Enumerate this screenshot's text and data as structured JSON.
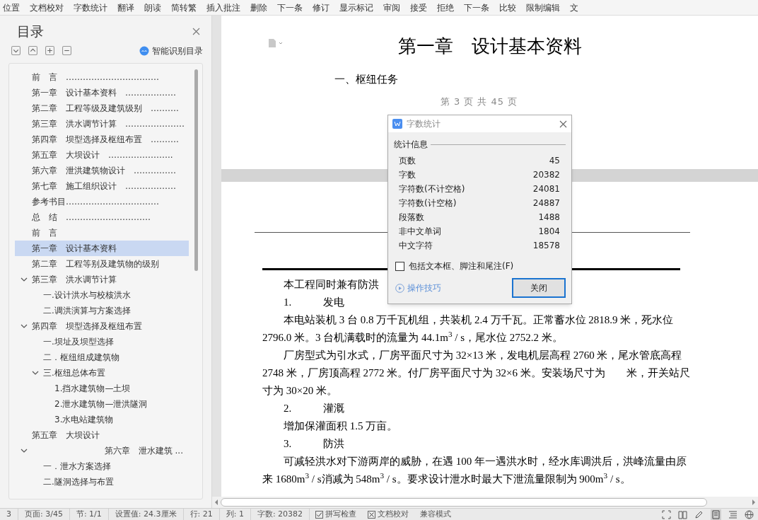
{
  "toolbar": [
    "位置",
    "文档校对",
    "字数统计",
    "翻译",
    "朗读",
    "简转繁",
    "插入批注",
    "删除",
    "下一条",
    "修订",
    "显示标记",
    "审阅",
    "接受",
    "拒绝",
    "下一条",
    "比较",
    "限制编辑",
    "文"
  ],
  "sidebar": {
    "title": "目录",
    "smart_button": "智能识别目录",
    "items": [
      {
        "text": "前　言　……………………………",
        "selected": false
      },
      {
        "text": "第一章　设计基本资料　………………",
        "selected": false
      },
      {
        "text": "第二章　工程等级及建筑级别　……….",
        "selected": false
      },
      {
        "text": "第三章　洪水调节计算　…………………",
        "selected": false
      },
      {
        "text": "第四章　坝型选择及枢纽布置　……….",
        "selected": false
      },
      {
        "text": "第五章　大坝设计　…………………..",
        "selected": false
      },
      {
        "text": "第六章　泄洪建筑物设计　……………",
        "selected": false
      },
      {
        "text": "第七章　施工组织设计　………………",
        "selected": false
      },
      {
        "text": "参考书目……………………………",
        "selected": false
      },
      {
        "text": "总　结　…………………………",
        "selected": false
      },
      {
        "text": "前　言",
        "selected": false
      },
      {
        "text": "第一章　设计基本资料",
        "selected": true
      },
      {
        "text": "第二章　工程等别及建筑物的级别",
        "selected": false
      },
      {
        "text": "第三章　洪水调节计算",
        "selected": false,
        "expanded": true,
        "children": [
          {
            "text": "一.设计洪水与校核洪水",
            "selected": false
          },
          {
            "text": "二.调洪演算与方案选择",
            "selected": false
          }
        ]
      },
      {
        "text": "第四章　坝型选择及枢纽布置",
        "selected": false,
        "expanded": true,
        "children": [
          {
            "text": "一.坝址及坝型选择",
            "selected": false
          },
          {
            "text": "二．枢纽组成建筑物",
            "selected": false
          },
          {
            "text": "三.枢纽总体布置",
            "selected": false,
            "expanded": true,
            "children": [
              {
                "text": "1.挡水建筑物—土坝",
                "selected": false
              },
              {
                "text": "2.泄水建筑物—泄洪隧洞",
                "selected": false
              },
              {
                "text": "3.水电站建筑物",
                "selected": false
              }
            ]
          }
        ]
      },
      {
        "text": "第五章　大坝设计",
        "selected": false
      },
      {
        "text": "第六章　泄水建筑 ...",
        "selected": false,
        "expanded": true,
        "right_aligned": true,
        "children": [
          {
            "text": "一．泄水方案选择",
            "selected": false
          },
          {
            "text": "二.隧洞选择与布置",
            "selected": false
          }
        ]
      }
    ]
  },
  "page1": {
    "chapter_title": "第一章　设计基本资料",
    "section": "一、枢纽任务",
    "page_number": "第 3 页 共 45 页"
  },
  "page2": {
    "body": [
      {
        "kind": "para",
        "text": "本工程同时兼有防洪"
      },
      {
        "kind": "list",
        "number": "1.",
        "label": "发电"
      },
      {
        "kind": "para",
        "text": "本电站装机 3 台 0.8 万千瓦机组，共装机 2.4 万千瓦。正常蓄水位 2818.9 米，死水位 2796.0 米。3 台机满载时的流量为 44.1m$^{3}$ / s，尾水位 2752.2 米。"
      },
      {
        "kind": "para",
        "text": "厂房型式为引水式，厂房平面尺寸为 32×13 米，发电机层高程 2760 米，尾水管底高程 2748 米，厂房顶高程 2772 米。付厂房平面尺寸为 32×6 米。安装场尺寸为　　米，开关站尺寸为 30×20 米。"
      },
      {
        "kind": "list",
        "number": "2.",
        "label": "灌溉"
      },
      {
        "kind": "para",
        "text": "增加保灌面积 1.5 万亩。"
      },
      {
        "kind": "list",
        "number": "3.",
        "label": "防洪"
      },
      {
        "kind": "para",
        "text": "可减轻洪水对下游两岸的威胁，在遇 100 年一遇洪水时，经水库调洪后，洪峰流量由原来 1680m$^{3}$ / s消减为 548m$^{3}$ / s。要求设计泄水时最大下泄流量限制为 900m$^{3}$ / s。"
      }
    ]
  },
  "dialog": {
    "title": "字数统计",
    "group": "统计信息",
    "stats": [
      {
        "label": "页数",
        "value": "45"
      },
      {
        "label": "字数",
        "value": "20382"
      },
      {
        "label": "字符数(不计空格)",
        "value": "24081"
      },
      {
        "label": "字符数(计空格)",
        "value": "24887"
      },
      {
        "label": "段落数",
        "value": "1488"
      },
      {
        "label": "非中文单词",
        "value": "1804"
      },
      {
        "label": "中文字符",
        "value": "18578"
      }
    ],
    "checkbox": {
      "label": "包括文本框、脚注和尾注(F)",
      "checked": false
    },
    "tips_link": "操作技巧",
    "close_button": "关闭"
  },
  "status_bar": {
    "items": [
      "3",
      "页面: 3/45",
      "节: 1/1",
      "设置值: 24.3厘米",
      "行: 21",
      "列: 1",
      "字数: 20382"
    ],
    "toggles": [
      {
        "label": "拼写检查",
        "checked": true
      },
      {
        "label": "文档校对",
        "checked": false
      }
    ],
    "mode": "兼容模式"
  }
}
